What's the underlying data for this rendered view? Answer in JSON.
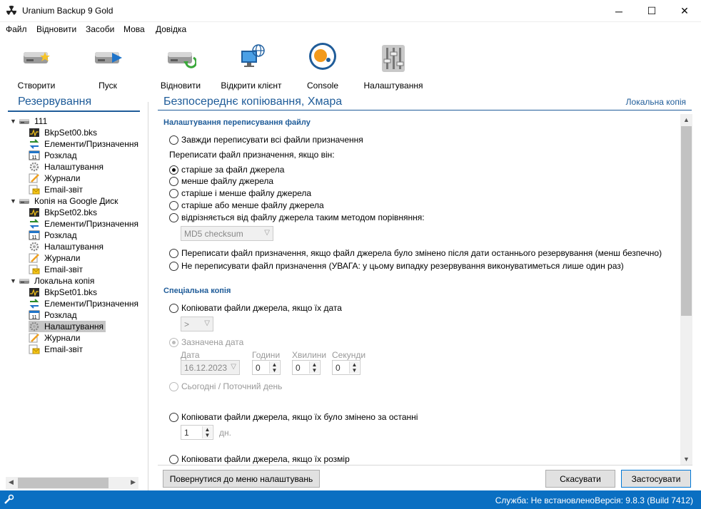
{
  "window": {
    "title": "Uranium Backup 9 Gold",
    "minimize": "─",
    "maximize": "☐",
    "close": "✕"
  },
  "menu": [
    "Файл",
    "Відновити",
    "Засоби",
    "Мова",
    "Довідка"
  ],
  "toolbar": [
    {
      "label": "Створити",
      "icon": "create-icon"
    },
    {
      "label": "Пуск",
      "icon": "start-icon"
    },
    {
      "label": "Відновити",
      "icon": "restore-icon"
    },
    {
      "label": "Відкрити клієнт",
      "icon": "open-client-icon"
    },
    {
      "label": "Console",
      "icon": "console-icon"
    },
    {
      "label": "Налаштування",
      "icon": "settings-icon"
    }
  ],
  "left": {
    "title": "Резервування",
    "tree": [
      {
        "label": "111",
        "level": 0,
        "icon": "drive",
        "expanded": true
      },
      {
        "label": "BkpSet00.bks",
        "level": 1,
        "icon": "set"
      },
      {
        "label": "Елементи/Призначення",
        "level": 1,
        "icon": "items"
      },
      {
        "label": "Розклад",
        "level": 1,
        "icon": "calendar"
      },
      {
        "label": "Налаштування",
        "level": 1,
        "icon": "gear"
      },
      {
        "label": "Журнали",
        "level": 1,
        "icon": "log"
      },
      {
        "label": "Email-звіт",
        "level": 1,
        "icon": "email"
      },
      {
        "label": "Копія на Google Диск",
        "level": 0,
        "icon": "drive",
        "expanded": true
      },
      {
        "label": "BkpSet02.bks",
        "level": 1,
        "icon": "set"
      },
      {
        "label": "Елементи/Призначення",
        "level": 1,
        "icon": "items"
      },
      {
        "label": "Розклад",
        "level": 1,
        "icon": "calendar"
      },
      {
        "label": "Налаштування",
        "level": 1,
        "icon": "gear"
      },
      {
        "label": "Журнали",
        "level": 1,
        "icon": "log"
      },
      {
        "label": "Email-звіт",
        "level": 1,
        "icon": "email"
      },
      {
        "label": "Локальна копія",
        "level": 0,
        "icon": "drive",
        "expanded": true
      },
      {
        "label": "BkpSet01.bks",
        "level": 1,
        "icon": "set"
      },
      {
        "label": "Елементи/Призначення",
        "level": 1,
        "icon": "items"
      },
      {
        "label": "Розклад",
        "level": 1,
        "icon": "calendar"
      },
      {
        "label": "Налаштування",
        "level": 1,
        "icon": "gear",
        "selected": true
      },
      {
        "label": "Журнали",
        "level": 1,
        "icon": "log"
      },
      {
        "label": "Email-звіт",
        "level": 1,
        "icon": "email"
      }
    ]
  },
  "right": {
    "title": "Безпосереднє копіювання, Хмара",
    "link": "Локальна копія",
    "overwrite": {
      "heading": "Налаштування переписування файлу",
      "always": "Завжди переписувати всі файли призначення",
      "if_label": "Переписати файл призначення, якщо він:",
      "options": [
        {
          "label": "старіше за файл джерела",
          "checked": true
        },
        {
          "label": "менше файлу джерела",
          "checked": false
        },
        {
          "label": "старіше і менше файлу джерела",
          "checked": false
        },
        {
          "label": "старіше або менше файлу джерела",
          "checked": false
        },
        {
          "label": "відрізняється від файлу джерела таким методом порівняння:",
          "checked": false
        }
      ],
      "method": "MD5 checksum",
      "changed_after": "Переписати файл призначення, якщо файл джерела було змінено після дати останнього резервування (менш безпечно)",
      "never": "Не переписувати файл призначення (УВАГА: у цьому випадку резервування виконуватиметься лише один раз)"
    },
    "special": {
      "heading": "Спеціальна копія",
      "by_date": "Копіювати файли джерела, якщо їх дата",
      "operator": ">",
      "specified_date": "Зазначена дата",
      "date_label": "Дата",
      "date_value": "16.12.2023",
      "hours_label": "Години",
      "hours_value": "0",
      "minutes_label": "Хвилини",
      "minutes_value": "0",
      "seconds_label": "Секунди",
      "seconds_value": "0",
      "today": "Сьогодні / Поточний день",
      "changed_last": "Копіювати файли джерела, якщо їх було змінено за останні",
      "days_value": "1",
      "days_unit": "дн.",
      "by_size": "Копіювати файли джерела, якщо їх розмір"
    }
  },
  "buttons": {
    "back": "Повернутися до меню налаштувань",
    "cancel": "Скасувати",
    "apply": "Застосувати"
  },
  "status": {
    "service": "Служба: Не встановлено",
    "version": "Версія: 9.8.3 (Build 7412)"
  }
}
